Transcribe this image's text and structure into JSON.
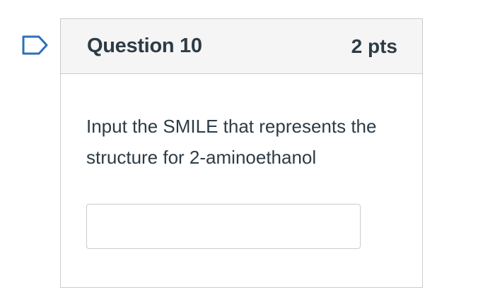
{
  "question": {
    "title": "Question 10",
    "points": "2 pts",
    "text": "Input the SMILE that represents the structure for 2-aminoethanol",
    "answer_value": "",
    "flag_icon": "flag-outline-icon"
  },
  "colors": {
    "flag_stroke": "#2d6fba",
    "header_bg": "#f5f5f5",
    "border": "#c7cdd1",
    "text": "#2d3b45"
  }
}
